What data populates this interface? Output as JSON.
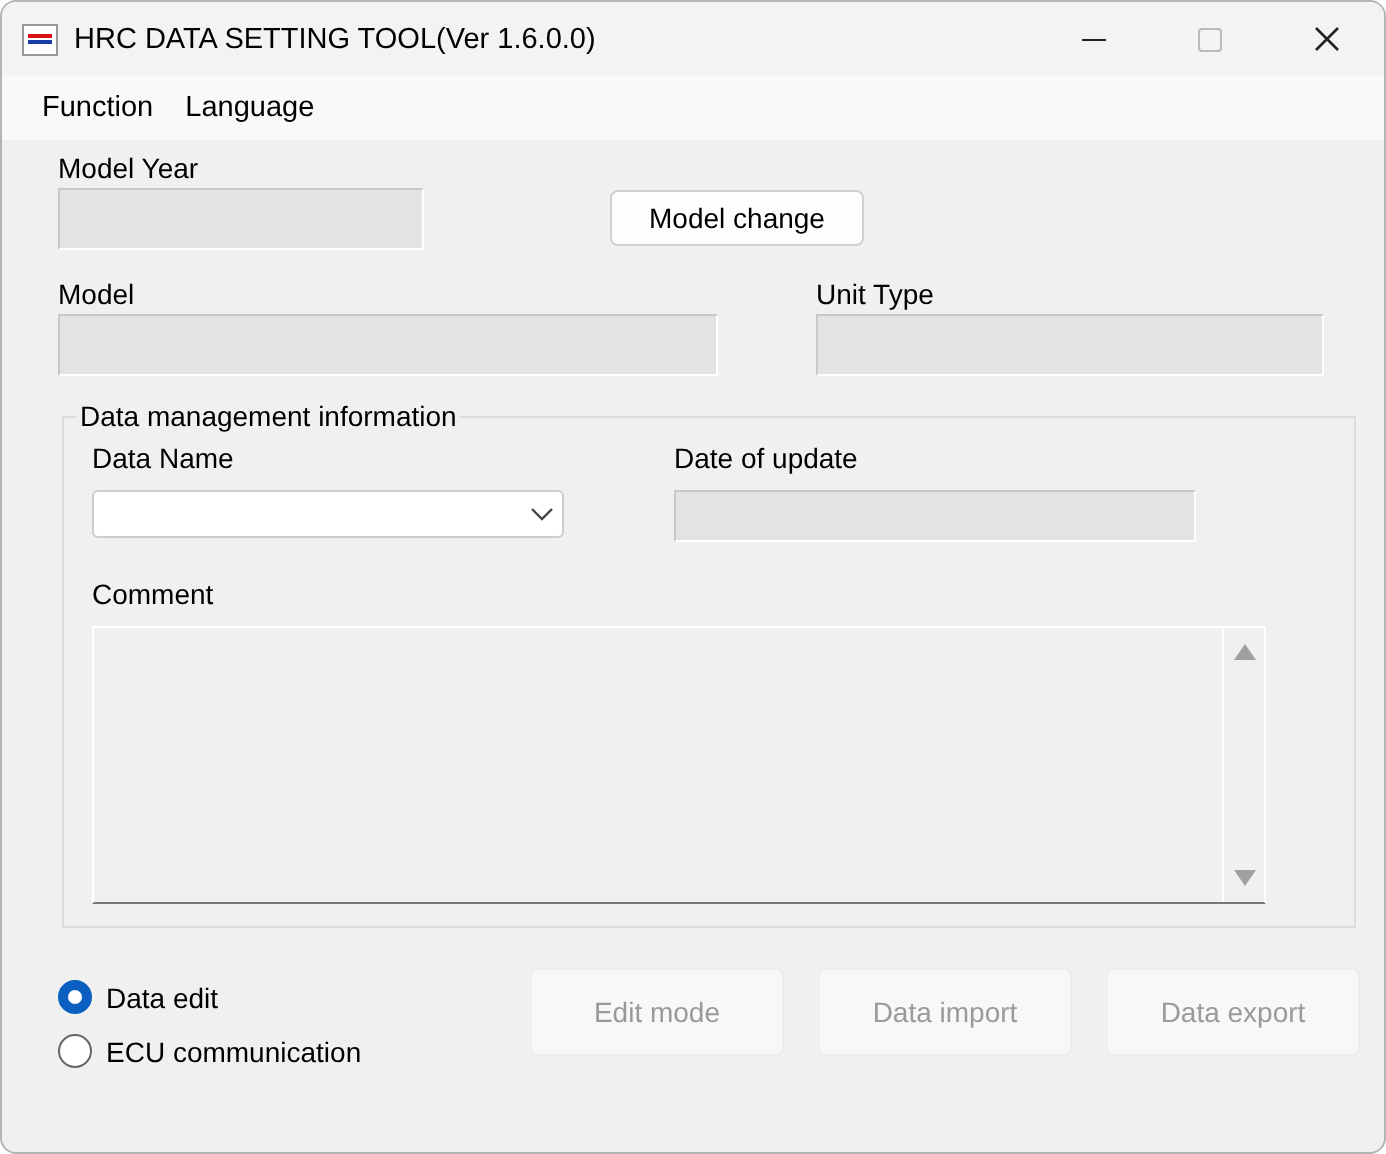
{
  "window": {
    "title": "HRC DATA SETTING TOOL(Ver 1.6.0.0)"
  },
  "menu": [
    "Function",
    "Language"
  ],
  "model_year": {
    "label": "Model Year",
    "disabled": true
  },
  "model_change_button": {
    "label": "Model change",
    "disabled": false
  },
  "model": {
    "label": "Model",
    "disabled": true
  },
  "unit_type": {
    "label": "Unit Type",
    "disabled": true
  },
  "data_management": {
    "title": "Data management information",
    "data_name": {
      "label": "Data Name"
    },
    "date_of_update": {
      "label": "Date of update",
      "disabled": true
    },
    "comment": {
      "label": "Comment"
    }
  },
  "modes": [
    {
      "label": "Data edit",
      "selected": true
    },
    {
      "label": "ECU communication",
      "selected": false
    }
  ],
  "actions": [
    {
      "label": "Edit mode",
      "disabled": true
    },
    {
      "label": "Data import",
      "disabled": true
    },
    {
      "label": "Data export",
      "disabled": true
    }
  ]
}
